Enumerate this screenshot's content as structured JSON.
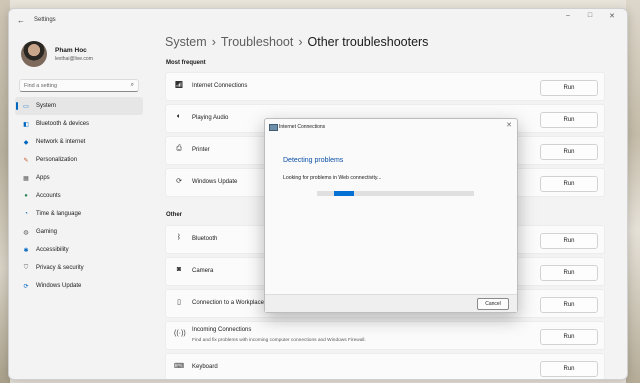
{
  "window": {
    "title": "Settings",
    "controls": [
      "–",
      "□",
      "✕"
    ]
  },
  "profile": {
    "name": "Pham Hoc",
    "email": "lexthai@live.com"
  },
  "search": {
    "placeholder": "Find a setting"
  },
  "sidebar": {
    "items": [
      {
        "label": "System",
        "icon": "system-icon",
        "active": true
      },
      {
        "label": "Bluetooth & devices",
        "icon": "bluetooth-devices-icon"
      },
      {
        "label": "Network & internet",
        "icon": "wifi-icon"
      },
      {
        "label": "Personalization",
        "icon": "brush-icon"
      },
      {
        "label": "Apps",
        "icon": "apps-icon"
      },
      {
        "label": "Accounts",
        "icon": "person-icon"
      },
      {
        "label": "Time & language",
        "icon": "globe-clock-icon"
      },
      {
        "label": "Gaming",
        "icon": "controller-icon"
      },
      {
        "label": "Accessibility",
        "icon": "accessibility-icon"
      },
      {
        "label": "Privacy & security",
        "icon": "shield-icon"
      },
      {
        "label": "Windows Update",
        "icon": "update-icon"
      }
    ]
  },
  "breadcrumb": {
    "parent1": "System",
    "parent2": "Troubleshoot",
    "current": "Other troubleshooters",
    "separator": "›"
  },
  "sections": {
    "most_frequent": "Most frequent",
    "other": "Other"
  },
  "most_frequent": [
    {
      "label": "Internet Connections",
      "icon": "signal-icon"
    },
    {
      "label": "Playing Audio",
      "icon": "speaker-icon"
    },
    {
      "label": "Printer",
      "icon": "printer-icon"
    },
    {
      "label": "Windows Update",
      "icon": "update-icon"
    }
  ],
  "other": [
    {
      "label": "Bluetooth",
      "icon": "bluetooth-icon"
    },
    {
      "label": "Camera",
      "icon": "camera-icon"
    },
    {
      "label": "Connection to a Workplace",
      "icon": "phone-icon"
    },
    {
      "label": "Incoming Connections",
      "sub": "Find and fix problems with incoming computer connections and Windows Firewall.",
      "icon": "incoming-icon"
    },
    {
      "label": "Keyboard",
      "icon": "keyboard-icon"
    }
  ],
  "run_label": "Run",
  "dialog": {
    "title": "Internet Connections",
    "heading": "Detecting problems",
    "status": "Looking for problems in Web connectivity...",
    "cancel": "Cancel",
    "progress_fraction": 0.14
  },
  "colors": {
    "accent": "#0067c0",
    "heading": "#0a4ea8",
    "progress": "#0671d4"
  }
}
